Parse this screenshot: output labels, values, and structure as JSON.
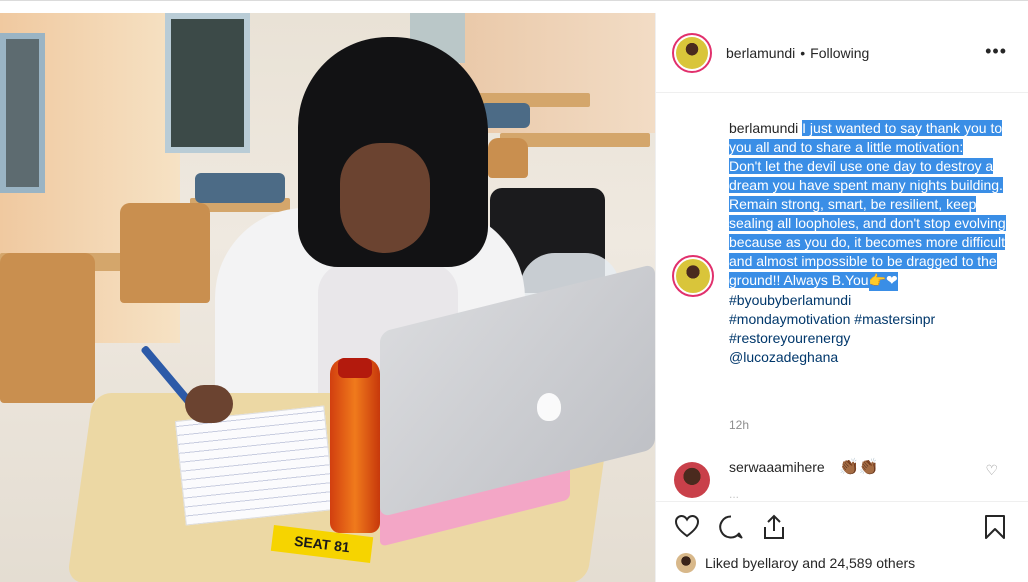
{
  "photo": {
    "seat_label": "SEAT 81"
  },
  "header": {
    "username": "berlamundi",
    "separator": "•",
    "follow_status": "Following",
    "more_icon": "more-horizontal-icon"
  },
  "caption": {
    "username": "berlamundi",
    "text_line1": "I just wanted to say thank you to you all and to share a little motivation:",
    "text_line2": "Don't let the devil use one day to destroy a dream you have spent many nights building. Remain strong, smart, be resilient, keep sealing all loopholes, and don't stop evolving because as you do, it becomes more difficult and almost impossible to be dragged to the ground!! Always B.You",
    "emoji": "👉❤",
    "hashtags": [
      "#byoubyberlamundi",
      "#mondaymotivation #mastersinpr",
      "#restoreyourenergy",
      "@lucozadeghana"
    ],
    "time": "12h"
  },
  "comment": {
    "username": "serwaaamihere",
    "emoji": "👏🏾👏🏾",
    "faded": "...",
    "like_icon": "heart-outline-icon"
  },
  "actions": {
    "like_icon": "heart-icon",
    "comment_icon": "comment-icon",
    "share_icon": "share-icon",
    "save_icon": "bookmark-icon"
  },
  "likes": {
    "prefix": "Liked by ",
    "user": "ellaroy",
    "middle": " and ",
    "count": "24,589 others"
  },
  "colors": {
    "highlight": "#3a8ee6",
    "story_ring": "#e1306c",
    "link": "#00376b"
  }
}
